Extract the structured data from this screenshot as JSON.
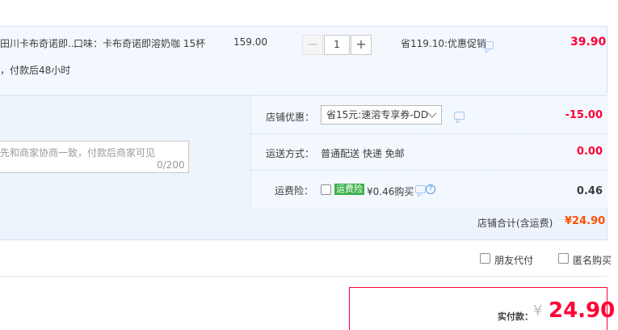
{
  "item": {
    "title": "田川卡布奇诺即...",
    "spec": "口味：卡布奇诺即溶奶咖 15杯",
    "unit_price": "159.00",
    "quantity": "1",
    "minus_label": "−",
    "plus_label": "+",
    "promo": "省119.10:优惠促销",
    "total": "39.90",
    "delivery_note": "，付款后48小时"
  },
  "shop": {
    "coupon_label": "店铺优惠：",
    "coupon_selected": "省15元:速溶专享券-DD",
    "coupon_amount": "-15.00",
    "shipping_label": "运送方式：",
    "shipping_value": "普通配送 快递 免邮",
    "shipping_amount": "0.00",
    "insurance_label": "运费险：",
    "insurance_badge": "运费险",
    "insurance_text": "¥0.46购买",
    "insurance_amount": "0.46",
    "message_placeholder": "先和商家协商一致，付款后商家可见",
    "message_count": "0/200",
    "subtotal_label": "店铺合计(含运费)",
    "subtotal_value": "¥24.90"
  },
  "options": {
    "friend_pay": "朋友代付",
    "anonymous": "匿名购买"
  },
  "payment": {
    "label": "实付款：",
    "currency": "¥",
    "amount": "24.90"
  },
  "colors": {
    "accent_red": "#ff0036",
    "subtotal_orange": "#ff5000",
    "panel_blue": "#f3f8fe",
    "insurance_green": "#3cb14a"
  }
}
